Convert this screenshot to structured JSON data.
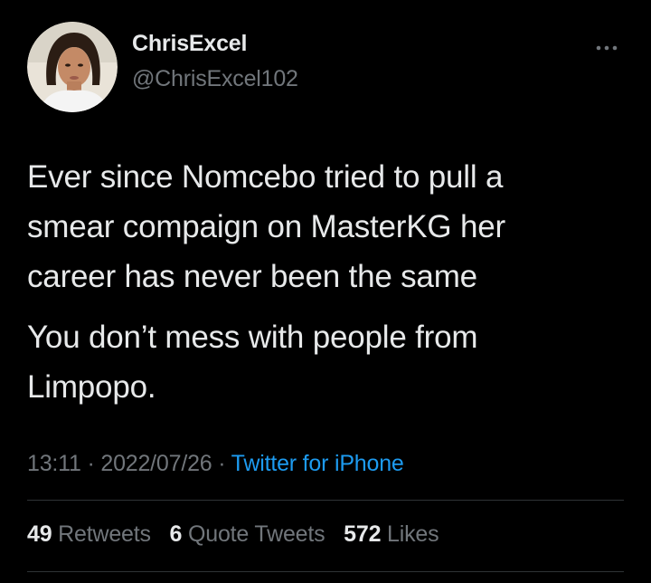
{
  "author": {
    "display_name": "ChrisExcel",
    "handle": "@ChrisExcel102"
  },
  "icons": {
    "avatar": "profile-photo",
    "more": "more-horizontal-icon"
  },
  "tweet": {
    "paragraphs": [
      "Ever since Nomcebo tried to pull a\nsmear compaign on MasterKG her\ncareer has never been the same",
      "You don’t mess with people from\nLimpopo."
    ],
    "time": "13:11",
    "separator": "·",
    "date": "2022/07/26",
    "source": "Twitter for iPhone"
  },
  "stats": [
    {
      "count": "49",
      "label": "Retweets"
    },
    {
      "count": "6",
      "label": "Quote Tweets"
    },
    {
      "count": "572",
      "label": "Likes"
    }
  ],
  "colors": {
    "background": "#000000",
    "primary_text": "#e7e9ea",
    "secondary_text": "#71767b",
    "link": "#1d9bf0",
    "divider": "#2f3336"
  }
}
